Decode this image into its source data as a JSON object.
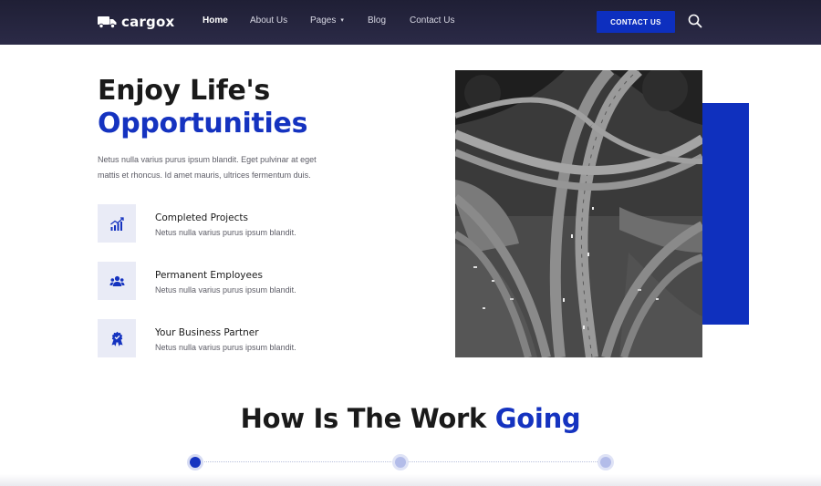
{
  "brand": {
    "name": "cargox",
    "icon": "truck-icon"
  },
  "nav": {
    "items": [
      {
        "label": "Home",
        "active": true
      },
      {
        "label": "About Us"
      },
      {
        "label": "Pages",
        "has_dropdown": true
      },
      {
        "label": "Blog"
      },
      {
        "label": "Contact Us"
      }
    ],
    "cta_label": "CONTACT US",
    "search_icon": "search-icon"
  },
  "hero": {
    "title_line1": "Enjoy Life's",
    "title_line2": "Opportunities",
    "description": "Netus nulla varius purus ipsum blandit. Eget pulvinar at eget mattis et rhoncus. Id amet mauris, ultrices fermentum duis."
  },
  "features": [
    {
      "icon": "chart-growth-icon",
      "title": "Completed Projects",
      "description": "Netus nulla varius purus ipsum blandit."
    },
    {
      "icon": "team-icon",
      "title": "Permanent Employees",
      "description": "Netus nulla varius purus ipsum blandit."
    },
    {
      "icon": "award-badge-icon",
      "title": "Your Business Partner",
      "description": "Netus nulla varius purus ipsum blandit."
    }
  ],
  "image": {
    "subject": "aerial-highway-interchange"
  },
  "work_section": {
    "title_main": "How Is The Work",
    "title_accent": "Going",
    "steps_count": 3,
    "active_step": 1
  },
  "colors": {
    "accent": "#1533c0",
    "navbar": "#25243f",
    "icon_bg": "#e9ebf6",
    "text_dark": "#1a1a1a",
    "text_muted": "#5c5c66"
  }
}
